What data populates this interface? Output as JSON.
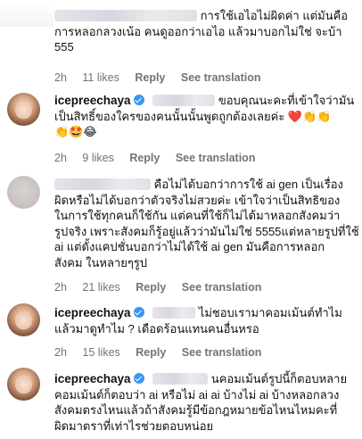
{
  "comments": [
    {
      "avatar": "redacted-avatar",
      "username": "",
      "lines": [
        "การใช้เอไอไม่ผิดค่า แต่มันคือ",
        "การหลอกลวงเน้อ คนดูออกว่าเอไอ แล้วมาบอกไม่ใช่ จะบ้า",
        "555"
      ],
      "time": "2h",
      "likes": "11 likes",
      "reply": "Reply",
      "translate": "See translation"
    },
    {
      "avatar": "icepreechaya-avatar",
      "username": "icepreechaya",
      "lines": [
        "ขอบคุณนะคะที่เข้าใจว่ามัน",
        "เป็นสิทธิ์ของใครของคนนั้นนั้นพูดถูกต้องเลยค่ะ ❤️👏👏",
        "👏🤩😂"
      ],
      "time": "2h",
      "likes": "9 likes",
      "reply": "Reply",
      "translate": "See translation"
    },
    {
      "avatar": "redacted-avatar",
      "username": "",
      "lines": [
        "คือไม่ได้บอกว่าการใช้ ai gen เป็นเรื่อง",
        "ผิดหรือไม่ได้บอกว่าตัวจริงไม่สวยค่ะ เข้าใจว่าเป็นสิทธิของ",
        "ในการใช้ทุกคนก็ใช้กัน แต่คนที่ใช้ก็ไม่ได้มาหลอกสังคมว่า",
        "รูปจริง เพราะสังคมก็รู้อยู่แล้วว่ามันไม่ใช่ 5555แต่หลายรูปที่ใช้",
        "ai แต่ดั้งแคปชั่นบอกว่าไม่ได้ใช้ ai gen มันคือการหลอก",
        "สังคม ในหลายๆรูป"
      ],
      "time": "2h",
      "likes": "21 likes",
      "reply": "Reply",
      "translate": "See translation"
    },
    {
      "avatar": "icepreechaya-avatar",
      "username": "icepreechaya",
      "lines": [
        "ไม่ชอบเรามาคอมเม้นต์ทำไม",
        "แล้วมาดูทำไม ? เดือดร้อนแทนคนอื่นหรอ"
      ],
      "time": "2h",
      "likes": "15 likes",
      "reply": "Reply",
      "translate": "See translation"
    },
    {
      "avatar": "icepreechaya-avatar",
      "username": "icepreechaya",
      "lines": [
        "นคอมเม้นต์รูปนี้ก็ตอบหลาย",
        "คอมเม้นต์ก็ตอบว่า ai หรือไม่ ai ai บ้างไม่ ai บ้างหลอกลวง",
        "สังคมตรงไหนแล้วถ้าสังคมรู้มีข้อกฎหมายข้อไหนไหมคะที่",
        "ผิดมาตราที่เท่าไรช่วยตอบหน่อย"
      ],
      "time": "",
      "likes": "",
      "reply": "",
      "translate": ""
    }
  ]
}
